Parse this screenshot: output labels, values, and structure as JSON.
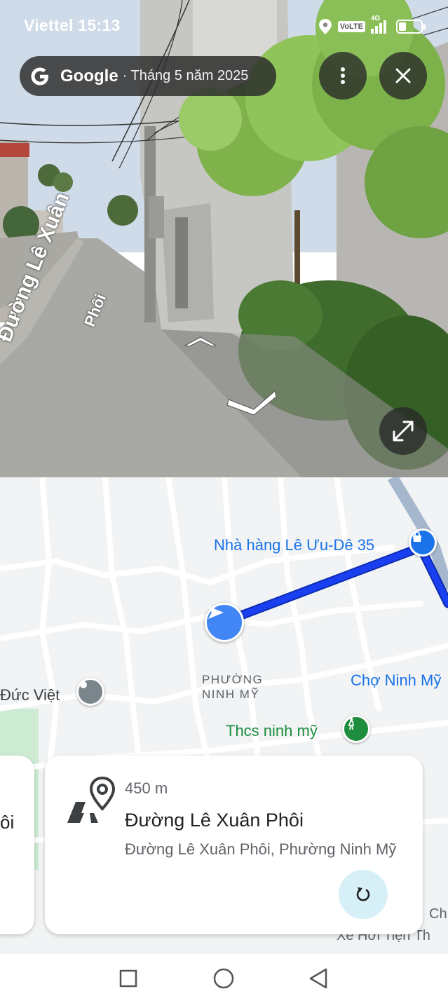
{
  "status_bar": {
    "carrier_time": "Viettel 15:13",
    "volte": "VoLTE",
    "network": "4G"
  },
  "street_view": {
    "brand": "Google",
    "date": "· Tháng 5 năm 2025",
    "street_label_1": "Đường Lê Xuân",
    "street_label_2": "Phôi"
  },
  "map": {
    "poi_restaurant": "Nhà hàng Lê Ưu-Dê 35",
    "poi_market": "Chợ Ninh Mỹ",
    "poi_school": "Thcs ninh mỹ",
    "poi_ducviet": "Đức Việt",
    "ward_line1": "PHƯỜNG",
    "ward_line2": "NINH MỸ",
    "poi_bottom": "Xe Hơi Tiện Th",
    "poi_bottom2": "Ch",
    "colors": {
      "route": "#1a3ff0",
      "road": "#ffffff",
      "land": "#f1f3f4",
      "highway": "#a5b7cc"
    }
  },
  "cards": {
    "prev_partial_text": "ôi",
    "main": {
      "distance": "450 m",
      "title": "Đường Lê Xuân Phôi",
      "subtitle": "Đường Lê Xuân Phôi, Phường Ninh Mỹ"
    }
  },
  "icons": {
    "location": "location-icon",
    "more": "more-vert-icon",
    "close": "close-icon",
    "expand": "expand-icon",
    "refresh": "refresh-icon"
  }
}
